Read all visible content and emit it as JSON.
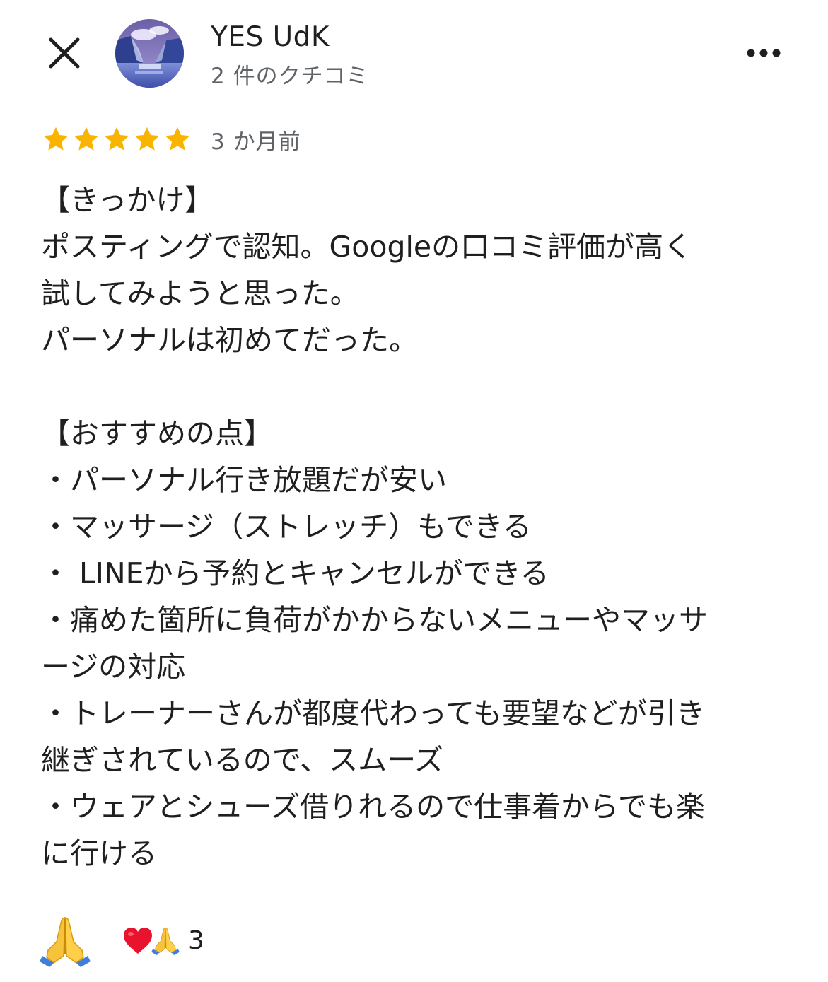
{
  "header": {
    "close_icon": "close-icon",
    "avatar_icon": "mountain-lake-avatar",
    "reviewer_name": "YES UdK",
    "review_count": "2 件のクチコミ",
    "more_icon": "more-horizontal-icon"
  },
  "review": {
    "rating": 5,
    "rating_max": 5,
    "star_color": "#f9b400",
    "time": "3 か月前",
    "lines": [
      "【きっかけ】",
      "ポスティングで認知。Googleの口コミ評価が高く",
      "試してみようと思った。",
      "パーソナルは初めてだった。",
      "",
      "【おすすめの点】",
      "・パーソナル行き放題だが安い",
      "・マッサージ（ストレッチ）もできる",
      "・ LINEから予約とキャンセルができる",
      "・痛めた箇所に負荷がかからないメニューやマッサ",
      "ージの対応",
      "・トレーナーさんが都度代わっても要望などが引き",
      "継ぎされているので、スムーズ",
      "・ウェアとシューズ借りれるので仕事着からでも楽",
      "に行ける"
    ]
  },
  "reactions": {
    "react_button_icon": "folded-hands-icon",
    "summary_icons": [
      "red-heart-icon",
      "folded-hands-icon"
    ],
    "count": "3"
  }
}
